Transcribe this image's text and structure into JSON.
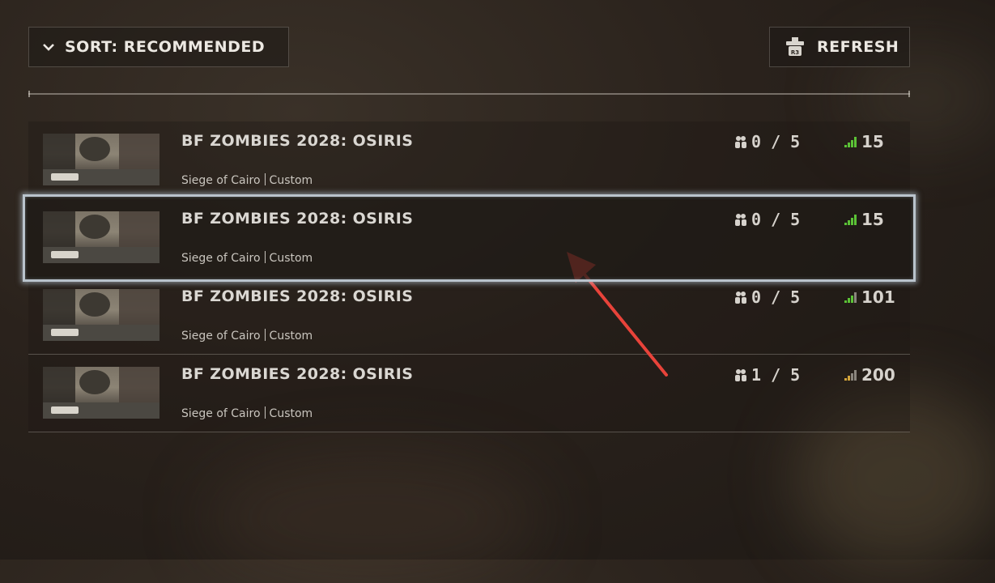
{
  "toolbar": {
    "sort_label": "SORT: RECOMMENDED",
    "refresh_label": "REFRESH",
    "refresh_key_hint": "R3"
  },
  "servers": [
    {
      "title": "BF ZOMBIES 2028: OSIRIS",
      "map": "Siege of Cairo",
      "mode": "Custom",
      "players": "0 / 5",
      "ping": "15",
      "ping_color": "#5bc236"
    },
    {
      "title": "BF ZOMBIES 2028: OSIRIS",
      "map": "Siege of Cairo",
      "mode": "Custom",
      "players": "0 / 5",
      "ping": "15",
      "ping_color": "#5bc236"
    },
    {
      "title": "BF ZOMBIES 2028: OSIRIS",
      "map": "Siege of Cairo",
      "mode": "Custom",
      "players": "0 / 5",
      "ping": "101",
      "ping_color": "#5bc236"
    },
    {
      "title": "BF ZOMBIES 2028: OSIRIS",
      "map": "Siege of Cairo",
      "mode": "Custom",
      "players": "1 / 5",
      "ping": "200",
      "ping_color": "#d2a43a"
    }
  ],
  "colors": {
    "selection_border": "#b9c3cc",
    "annotation_arrow": "#e8433a"
  },
  "icons": {
    "sort": "chevron-down-icon",
    "refresh": "r3-button-icon",
    "players": "players-icon",
    "ping": "signal-bars-icon"
  }
}
